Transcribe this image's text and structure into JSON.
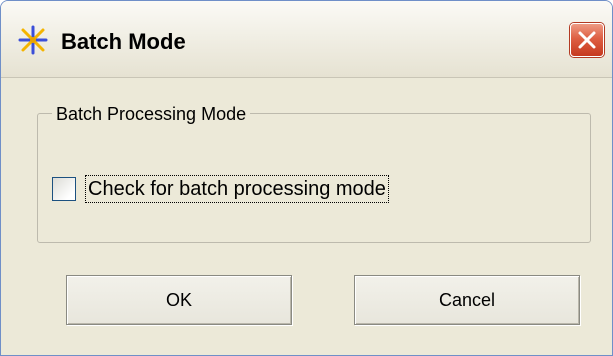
{
  "window": {
    "title": "Batch Mode",
    "icon": "batch-star-icon",
    "close_icon": "close-icon",
    "accent_color": "#de5f43"
  },
  "group": {
    "label": "Batch Processing Mode"
  },
  "checkbox": {
    "label": "Check for batch processing mode",
    "checked": false
  },
  "buttons": {
    "ok_label": "OK",
    "cancel_label": "Cancel"
  }
}
